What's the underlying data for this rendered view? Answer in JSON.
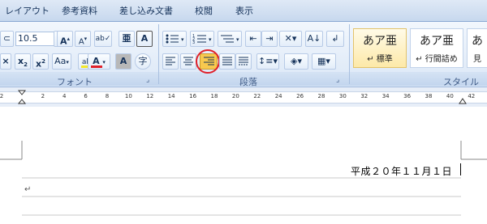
{
  "tabs": [
    "レイアウト",
    "参考資料",
    "差し込み文書",
    "校閲",
    "表示"
  ],
  "font_group": {
    "label": "フォント",
    "font_size": "10.5",
    "grow_label": "A",
    "shrink_label": "A",
    "change_case_label": "Aa",
    "font_color_label": "A",
    "char_shading_label": "A",
    "enclose_label": "字",
    "subscript_label": "x",
    "superscript_label": "x"
  },
  "paragraph_group": {
    "label": "段落"
  },
  "styles_group": {
    "label": "スタイル",
    "items": [
      {
        "preview": "あア亜",
        "name": "↵ 標準"
      },
      {
        "preview": "あア亜",
        "name": "↵ 行間詰め"
      },
      {
        "preview": "あ",
        "name": "見"
      }
    ]
  },
  "ruler": {
    "ticks": [
      "2",
      "",
      "2",
      "4",
      "6",
      "8",
      "10",
      "12",
      "14",
      "16",
      "18",
      "20",
      "22",
      "24",
      "26",
      "28",
      "30",
      "32",
      "34",
      "36",
      "38",
      "40",
      "42"
    ]
  },
  "document": {
    "date_text": "平成２０年１１月１日",
    "para_mark": "↵"
  },
  "colors": {
    "highlight_circle": "#e0202a",
    "selected_button": "#f8c94e",
    "font_color_bar": "#e0202a",
    "highlight_color_bar": "#f4e82a"
  }
}
